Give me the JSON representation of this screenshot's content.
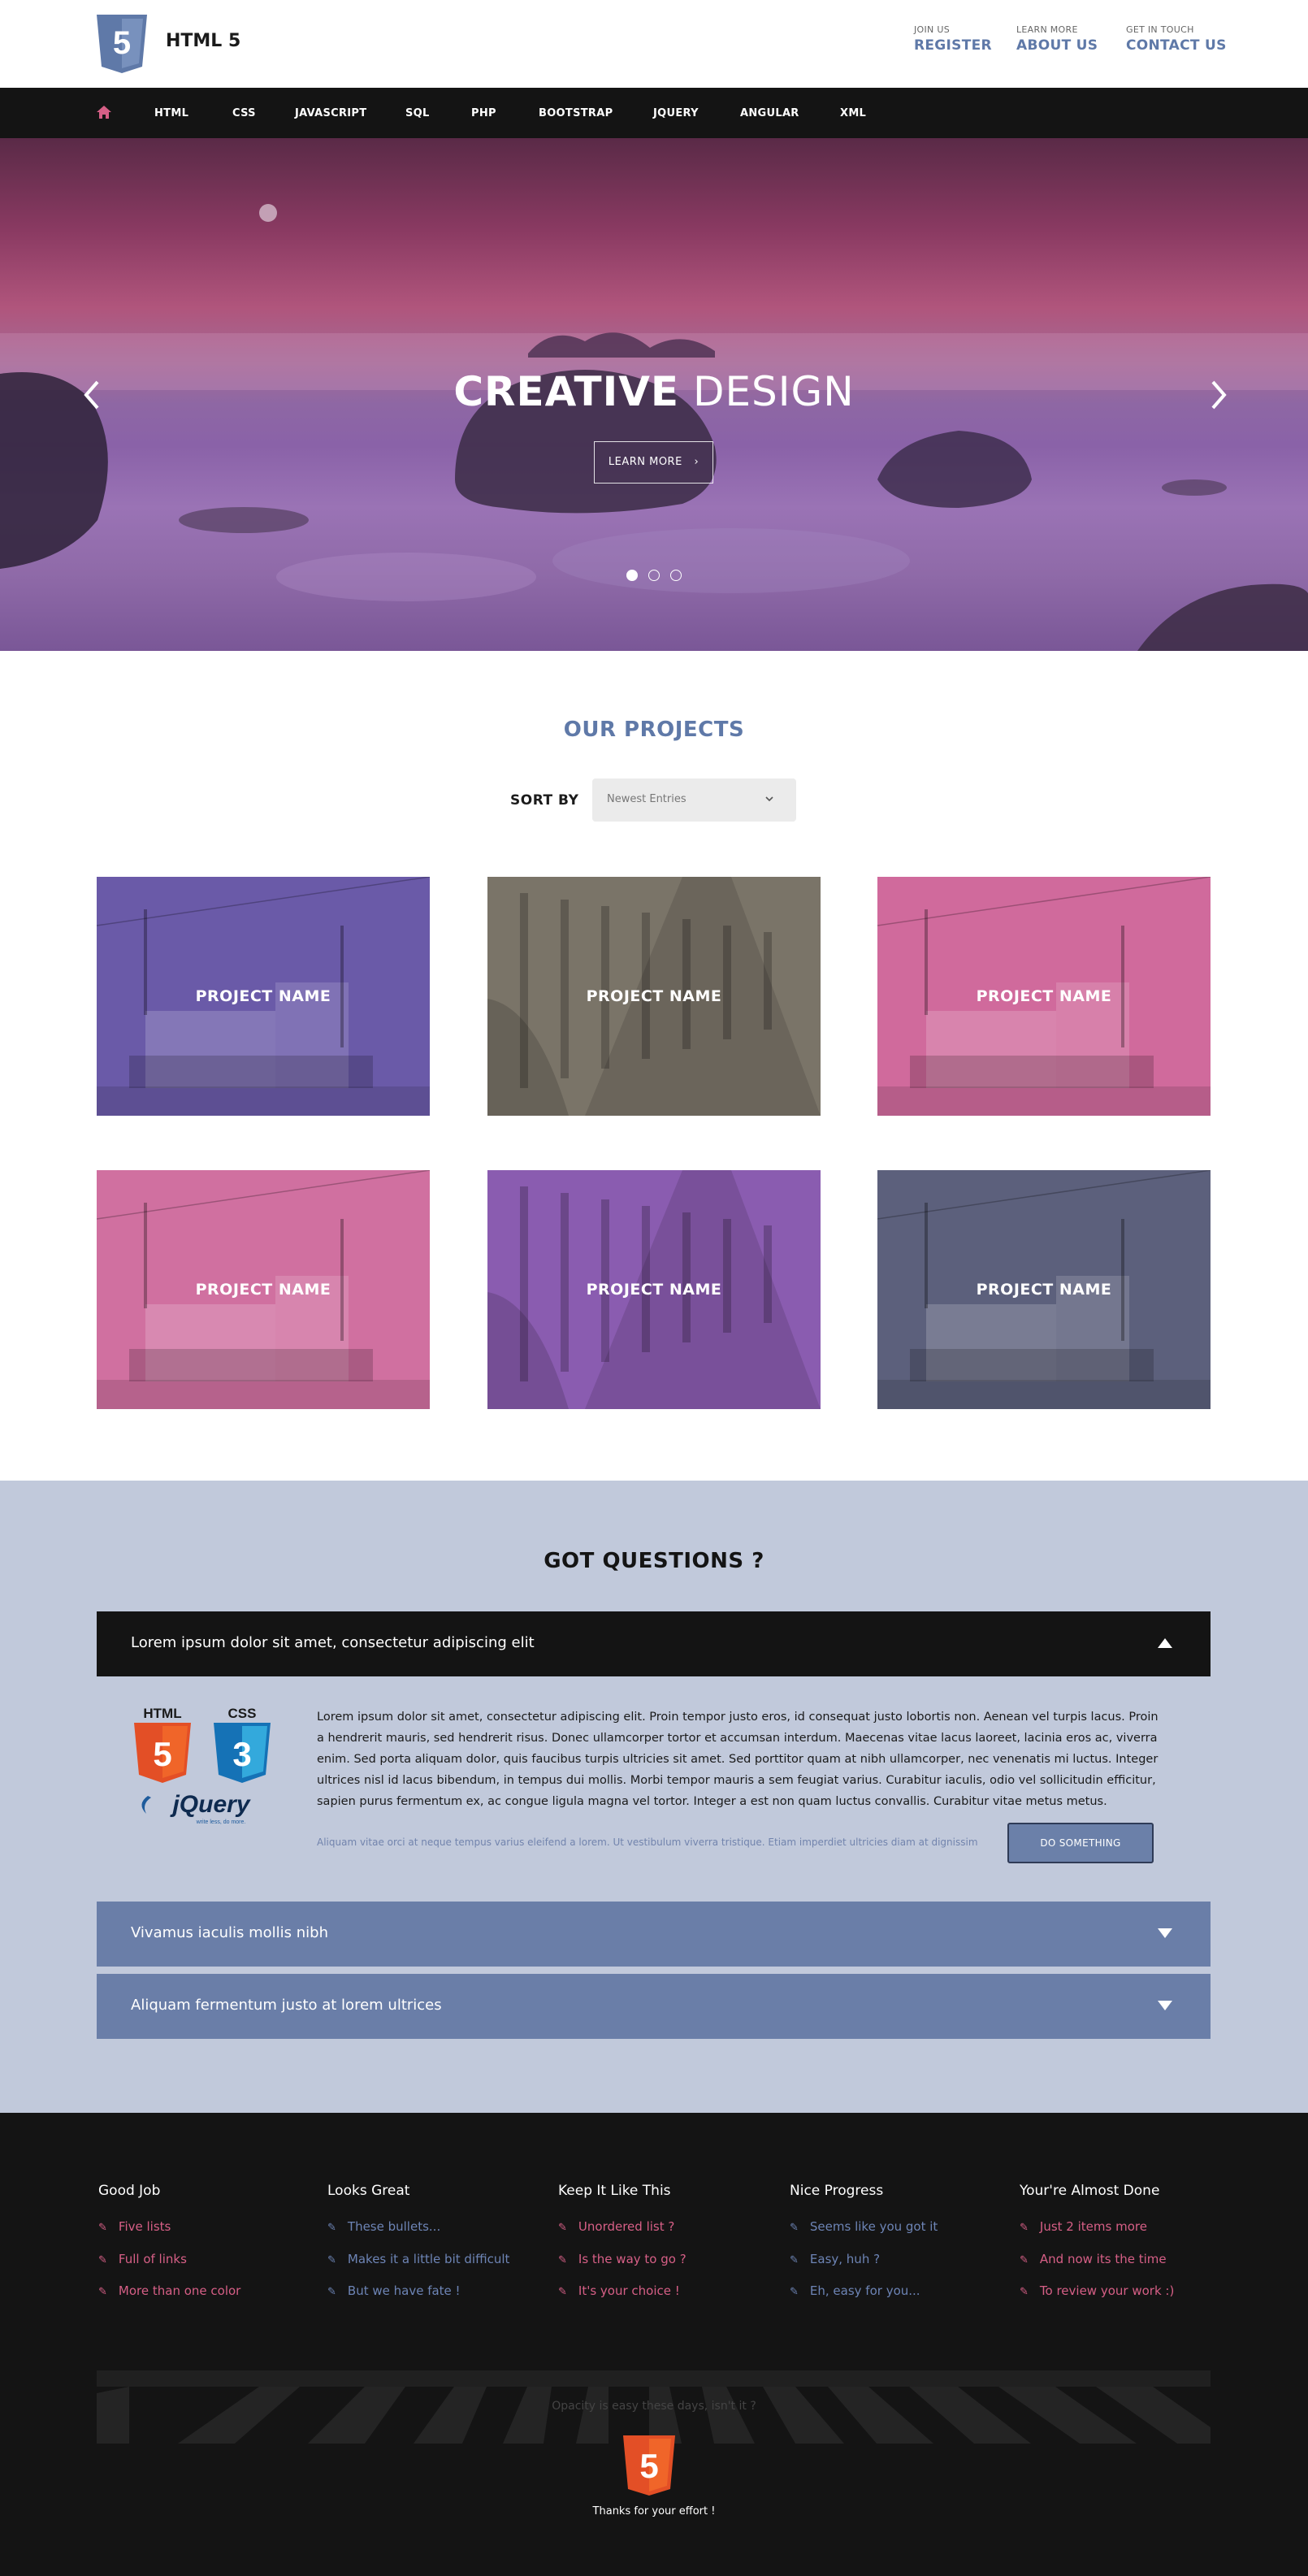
{
  "brand": {
    "logo_digit": "5",
    "name": "HTML 5"
  },
  "top_links": [
    {
      "small": "JOIN US",
      "big": "REGISTER"
    },
    {
      "small": "LEARN MORE",
      "big": "ABOUT US"
    },
    {
      "small": "GET IN TOUCH",
      "big": "CONTACT US"
    }
  ],
  "nav": {
    "home_icon": "home-icon",
    "items": [
      "HTML",
      "CSS",
      "JAVASCRIPT",
      "SQL",
      "PHP",
      "BOOTSTRAP",
      "JQUERY",
      "ANGULAR",
      "XML"
    ]
  },
  "hero": {
    "title_bold": "CREATIVE",
    "title_light": "DESIGN",
    "button": "LEARN MORE",
    "slides": 3,
    "active_slide": 1
  },
  "projects": {
    "title": "OUR PROJECTS",
    "sort_label": "SORT BY",
    "sort_value": "Newest Entries",
    "items": [
      {
        "name": "PROJECT NAME",
        "tint": "#6a5aa8"
      },
      {
        "name": "PROJECT NAME",
        "tint": "#7a7468"
      },
      {
        "name": "PROJECT NAME",
        "tint": "#d06a9c"
      },
      {
        "name": "PROJECT NAME",
        "tint": "#d070a0"
      },
      {
        "name": "PROJECT NAME",
        "tint": "#8a5cb0"
      },
      {
        "name": "PROJECT NAME",
        "tint": "#5c607c"
      }
    ]
  },
  "faq": {
    "title": "GOT QUESTIONS ?",
    "open": {
      "label": "Lorem ipsum dolor sit amet, consectetur adipiscing elit",
      "logos": {
        "html": "HTML",
        "css": "CSS",
        "jquery": "jQuery",
        "jquery_tag": "write less, do more."
      },
      "body": "Lorem ipsum dolor sit amet, consectetur adipiscing elit. Proin tempor justo eros, id consequat justo lobortis non. Aenean vel turpis lacus. Proin a hendrerit mauris, sed hendrerit risus. Donec ullamcorper tortor et accumsan interdum. Maecenas vitae lacus laoreet, lacinia eros ac, viverra enim. Sed porta aliquam dolor, quis faucibus turpis ultricies sit amet. Sed porttitor quam at nibh ullamcorper, nec venenatis mi luctus. Integer ultrices nisl id lacus bibendum, in tempus dui mollis. Morbi tempor mauris a sem feugiat varius. Curabitur iaculis, odio vel sollicitudin efficitur, sapien purus fermentum ex, ac congue ligula magna vel tortor. Integer a est non quam luctus convallis. Curabitur vitae metus metus.",
      "footnote": "Aliquam vitae orci at neque tempus varius eleifend a lorem. Ut vestibulum viverra tristique. Etiam imperdiet ultricies diam at dignissim",
      "button": "DO SOMETHING"
    },
    "closed": [
      {
        "label": "Vivamus iaculis mollis nibh"
      },
      {
        "label": "Aliquam fermentum justo at lorem ultrices"
      }
    ]
  },
  "footer": {
    "columns": [
      {
        "title": "Good Job",
        "color": "#d65f86",
        "links": [
          "Five lists",
          "Full of links",
          "More than one color"
        ]
      },
      {
        "title": "Looks Great",
        "color": "#6d84b5",
        "links": [
          "These bullets...",
          "Makes it a little bit difficult",
          "But we have fate !"
        ]
      },
      {
        "title": "Keep It Like This",
        "color": "#d65f86",
        "links": [
          "Unordered list ?",
          "Is the way to go ?",
          "It's your choice !"
        ]
      },
      {
        "title": "Nice Progress",
        "color": "#6d84b5",
        "links": [
          "Seems like you got it",
          "Easy, huh ?",
          "Eh, easy for you..."
        ]
      },
      {
        "title": "Your're Almost Done",
        "color": "#d65f86",
        "links": [
          "Just 2 items more",
          "And now its the time",
          "To review your work :)"
        ]
      }
    ],
    "opacity_text": "Opacity is easy these days, isn't it ?",
    "thanks": "Thanks for your effort !"
  },
  "colors": {
    "accent": "#5f79a8",
    "pink": "#d65f86",
    "dark": "#141414",
    "faq_bg": "#c1c9db",
    "acc_closed": "#6a7ea8"
  }
}
